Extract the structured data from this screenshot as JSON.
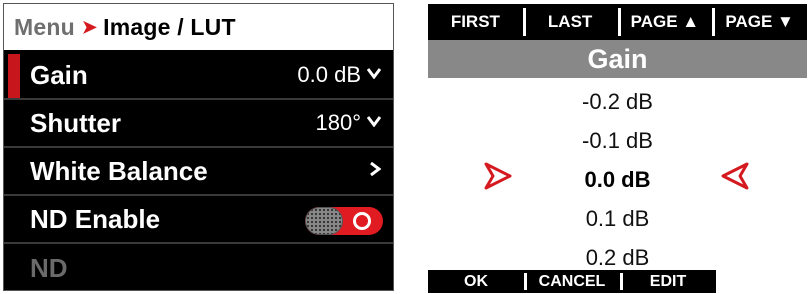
{
  "menu": {
    "breadcrumb_root": "Menu",
    "breadcrumb_separator": "➤",
    "breadcrumb_current": "Image / LUT",
    "rows": [
      {
        "label": "Gain",
        "value": "0.0 dB",
        "indicator": "chevron-down"
      },
      {
        "label": "Shutter",
        "value": "180°",
        "indicator": "chevron-down"
      },
      {
        "label": "White Balance",
        "value": "",
        "indicator": "chevron-right"
      },
      {
        "label": "ND Enable",
        "value": "",
        "indicator": "toggle-on"
      },
      {
        "label": "ND",
        "value": "",
        "indicator": "disabled"
      }
    ]
  },
  "picker": {
    "top_softkeys": [
      "FIRST",
      "LAST",
      "PAGE ▲",
      "PAGE ▼"
    ],
    "title": "Gain",
    "options": [
      "-0.2 dB",
      "-0.1 dB",
      "0.0 dB",
      "0.1 dB",
      "0.2 dB"
    ],
    "selected_index": 2,
    "bottom_softkeys": [
      "OK",
      "CANCEL",
      "EDIT"
    ]
  },
  "colors": {
    "accent_red": "#d4191f",
    "selection_bar": "#c8171c",
    "title_bar_gray": "#888888"
  }
}
